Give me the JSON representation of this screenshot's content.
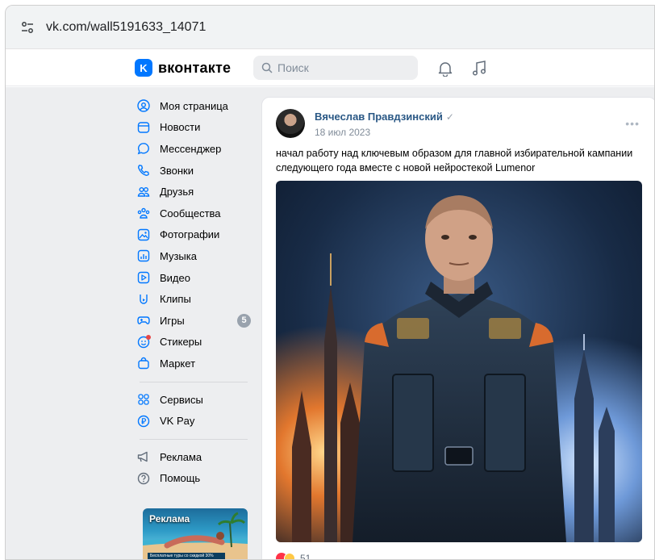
{
  "browser": {
    "url": "vk.com/wall5191633_14071",
    "icons": [
      "tune-icon"
    ]
  },
  "header": {
    "logo_badge": "K",
    "logo_text": "вконтакте",
    "search_placeholder": "Поиск",
    "icons": [
      "search-icon",
      "bell-icon",
      "music-icon"
    ]
  },
  "sidebar": {
    "items": [
      {
        "label": "Моя страница",
        "icon": "user-circle-icon"
      },
      {
        "label": "Новости",
        "icon": "news-icon"
      },
      {
        "label": "Мессенджер",
        "icon": "message-icon"
      },
      {
        "label": "Звонки",
        "icon": "phone-icon"
      },
      {
        "label": "Друзья",
        "icon": "friends-icon"
      },
      {
        "label": "Сообщества",
        "icon": "communities-icon"
      },
      {
        "label": "Фотографии",
        "icon": "photo-icon"
      },
      {
        "label": "Музыка",
        "icon": "music-icon"
      },
      {
        "label": "Видео",
        "icon": "video-icon"
      },
      {
        "label": "Клипы",
        "icon": "clips-icon"
      },
      {
        "label": "Игры",
        "icon": "gamepad-icon",
        "badge": "5"
      },
      {
        "label": "Стикеры",
        "icon": "sticker-icon"
      },
      {
        "label": "Маркет",
        "icon": "market-bag-icon"
      }
    ],
    "group2": [
      {
        "label": "Сервисы",
        "icon": "services-grid-icon"
      },
      {
        "label": "VK Pay",
        "icon": "vkpay-icon"
      }
    ],
    "group3": [
      {
        "label": "Реклама",
        "icon": "megaphone-icon"
      },
      {
        "label": "Помощь",
        "icon": "help-icon"
      }
    ],
    "ad": {
      "title": "Реклама",
      "strip": "Бесплатные туры со скидкой 30%"
    }
  },
  "post": {
    "author": "Вячеслав Правдзинский",
    "verified_mark": "✓",
    "date": "18 июл 2023",
    "text": "начал работу над ключевым образом для главной избирательной кампании следующего года вместе с новой нейростекой Lumenor",
    "more": "•••",
    "reactions_count": "51",
    "colors": {
      "link": "#2a5885",
      "accent": "#0077ff"
    }
  }
}
